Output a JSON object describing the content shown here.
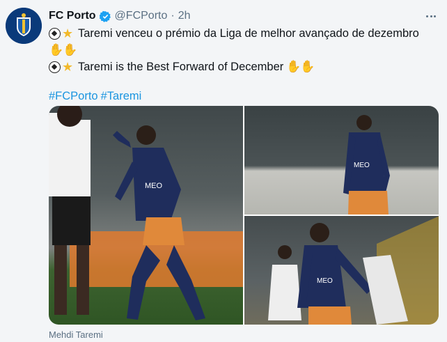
{
  "tweet": {
    "author_name": "FC Porto",
    "handle": "@FCPorto",
    "separator": "·",
    "time": "2h",
    "line1_text": "Taremi venceu o prémio da Liga de melhor avançado de dezembro",
    "line3_text": "Taremi is the Best Forward of December",
    "hashtags": [
      "#FCPorto",
      "#Taremi"
    ],
    "emojis": [
      "soccer-ball",
      "star",
      "clapping-hands"
    ]
  },
  "media": {
    "image_count": 3,
    "caption": "Mehdi Taremi",
    "shirt_sponsor": "MEO"
  },
  "colors": {
    "link": "#1b95e0",
    "secondary_text": "#5b7083",
    "verified": "#1da1f2",
    "kit_navy": "#1f2d5c",
    "kit_orange": "#e0893a"
  }
}
